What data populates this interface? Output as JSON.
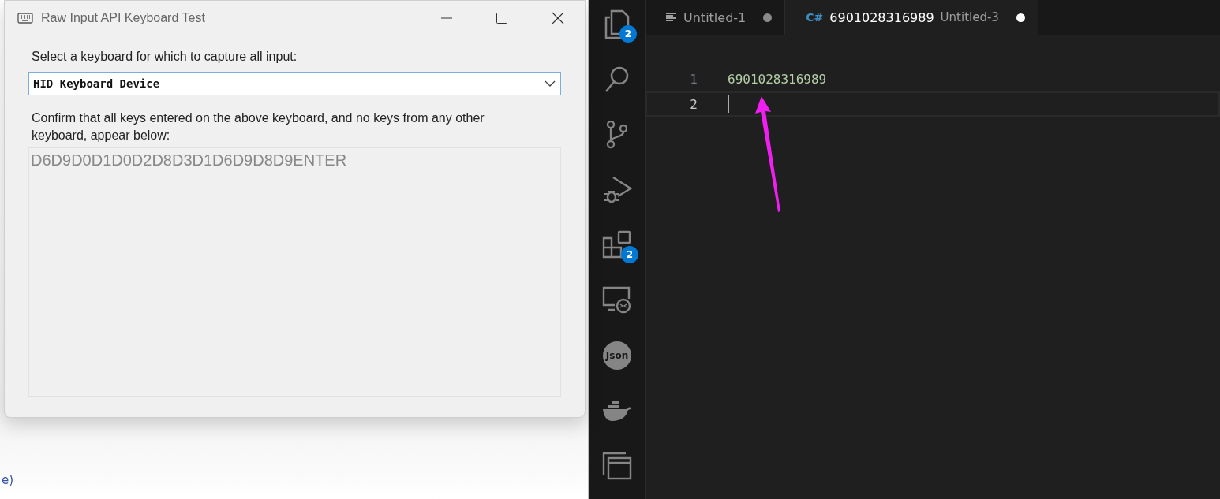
{
  "background": {
    "text": "e)"
  },
  "dialog": {
    "title": "Raw Input API Keyboard Test",
    "select_label": "Select a keyboard for which to capture all input:",
    "keyboard_select": {
      "value": "HID Keyboard Device"
    },
    "confirm_text": "Confirm that all keys entered on the above keyboard, and no keys from any other keyboard, appear below:",
    "captured_keys": "D6D9D0D1D0D2D8D3D1D6D9D8D9ENTER"
  },
  "activity_bar": [
    {
      "kind": "files",
      "badge": "2"
    },
    {
      "kind": "search"
    },
    {
      "kind": "source-control"
    },
    {
      "kind": "debug"
    },
    {
      "kind": "extensions",
      "badge": "2"
    },
    {
      "kind": "remote"
    },
    {
      "kind": "json",
      "label": "Json"
    },
    {
      "kind": "docker"
    },
    {
      "kind": "windows"
    }
  ],
  "tabs": [
    {
      "kind": "text",
      "title": "Untitled-1",
      "selected": false,
      "modified": true
    },
    {
      "kind": "csharp",
      "icon": "C#",
      "title": "6901028316989",
      "description": "Untitled-3",
      "selected": true,
      "modified": true
    }
  ],
  "editor": {
    "lines": [
      {
        "number": "1",
        "text": "6901028316989",
        "current": false
      },
      {
        "number": "2",
        "current": true
      }
    ]
  }
}
